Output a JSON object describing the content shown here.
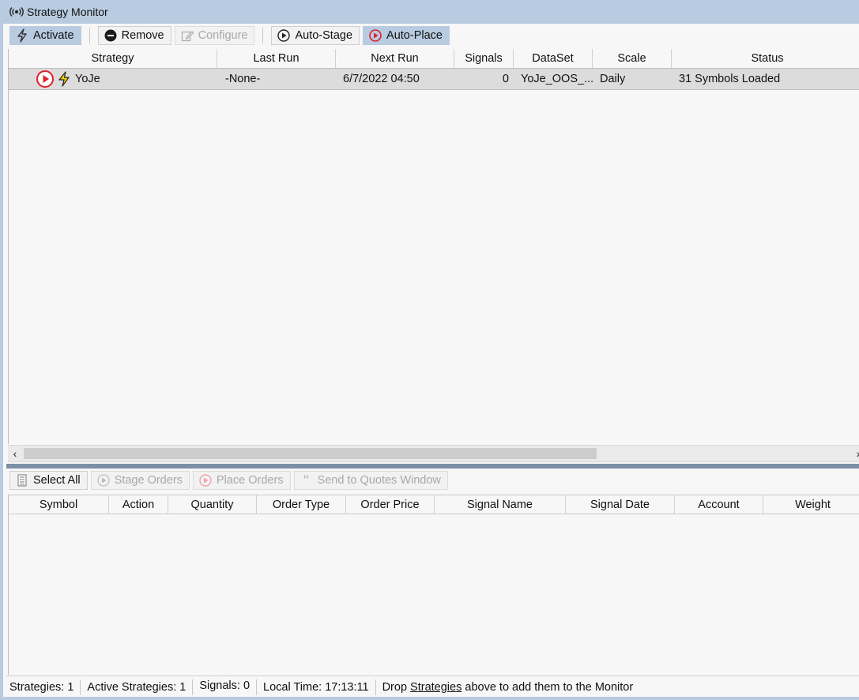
{
  "window": {
    "title": "Strategy Monitor",
    "title_icon": "broadcast-icon"
  },
  "toolbar": {
    "activate": "Activate",
    "remove": "Remove",
    "configure": "Configure",
    "auto_stage": "Auto-Stage",
    "auto_place": "Auto-Place"
  },
  "strategy_grid": {
    "columns": [
      "Strategy",
      "Last Run",
      "Next Run",
      "Signals",
      "DataSet",
      "Scale",
      "Status"
    ],
    "rows": [
      {
        "strategy": "YoJe",
        "last_run": "-None-",
        "next_run": "6/7/2022 04:50",
        "signals": "0",
        "dataset": "YoJe_OOS_...",
        "scale": "Daily",
        "status": "31 Symbols Loaded"
      }
    ]
  },
  "orders_toolbar": {
    "select_all": "Select All",
    "stage_orders": "Stage Orders",
    "place_orders": "Place Orders",
    "send_to_quotes": "Send to Quotes Window"
  },
  "orders_grid": {
    "columns": [
      "Symbol",
      "Action",
      "Quantity",
      "Order Type",
      "Order Price",
      "Signal Name",
      "Signal Date",
      "Account",
      "Weight"
    ]
  },
  "statusbar": {
    "strategies": "Strategies: 1",
    "active_strategies": "Active Strategies: 1",
    "signals": "Signals: 0",
    "local_time": "Local Time: 17:13:11",
    "drop_prefix": "Drop",
    "drop_link": "Strategies",
    "drop_suffix": "above to add them to the Monitor"
  },
  "colors": {
    "accent": "#b8cbe0",
    "red": "#e0202a",
    "bolt": "#e8c800",
    "splitter": "#7d8fa5"
  }
}
